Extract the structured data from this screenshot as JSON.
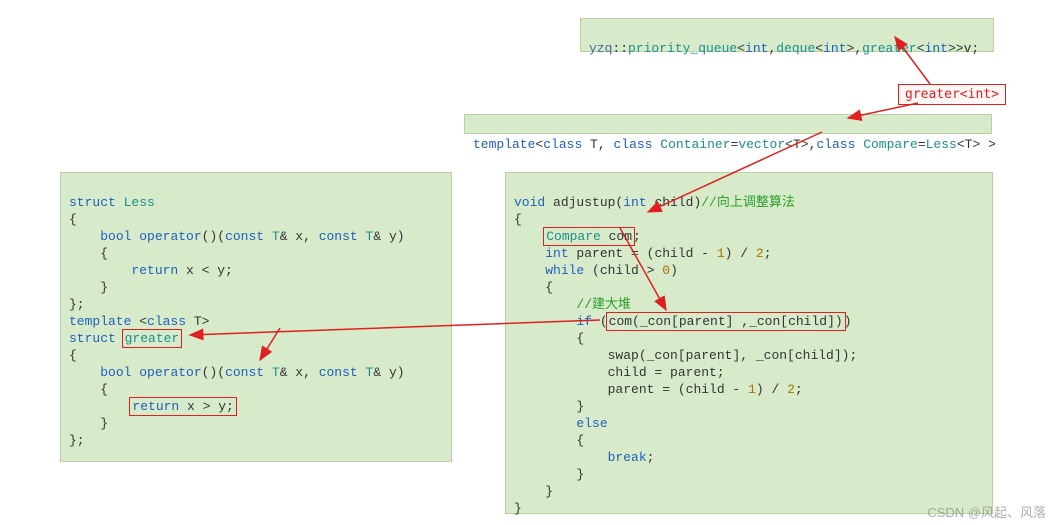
{
  "top_line": {
    "ns1": "yzq",
    "sep": "::",
    "pq": "priority_queue",
    "lt": "<",
    "int1": "int",
    "c1": ",",
    "deque": "deque",
    "lt2": "<",
    "int2": "int",
    "gt2": ">",
    "c2": ",",
    "greater": "greater",
    "lt3": "<",
    "int3": "int",
    "gt3": ">>",
    "v": "v;"
  },
  "annotation_greater": "greater<int>",
  "template_line": {
    "template": "template",
    "lt": "<",
    "class1": "class",
    "T1": " T",
    "c1": ", ",
    "class2": "class",
    "Container": " Container",
    "eq1": "=",
    "vector": "vector",
    "lt2": "<",
    "T2": "T",
    "gt2": ">",
    "c2": ",",
    "class3": "class",
    "Compare": " Compare",
    "eq2": "=",
    "Less": "Less",
    "lt3": "<",
    "T3": "T",
    "gt3": "> ",
    "gt_outer": ">"
  },
  "left_panel": {
    "l1_struct": "struct",
    "l1_Less": " Less",
    "l2": "{",
    "l3_bool": "bool",
    "l3_op": " operator",
    "l3_par": "()(",
    "l3_const1": "const",
    "l3_T1": " T",
    "l3_amp1": "& ",
    "l3_x": "x, ",
    "l3_const2": "const",
    "l3_T2": " T",
    "l3_amp2": "& ",
    "l3_y": "y)",
    "l4": "{",
    "l5_return": "return",
    "l5_expr": " x < y;",
    "l6": "}",
    "l7": "};",
    "l8_template": "template",
    "l8_lt": " <",
    "l8_class": "class",
    "l8_T": " T",
    "l8_gt": ">",
    "l9_struct": "struct",
    "l9_greater": "greater",
    "l10": "{",
    "l11_bool": "bool",
    "l11_op": " operator",
    "l11_par": "()(",
    "l11_const1": "const",
    "l11_T1": " T",
    "l11_amp1": "& ",
    "l11_x": "x, ",
    "l11_const2": "const",
    "l11_T2": " T",
    "l11_amp2": "& ",
    "l11_y": "y)",
    "l12": "{",
    "l13_return": "return",
    "l13_expr": " x > y;",
    "l14": "}",
    "l15": "};"
  },
  "right_panel": {
    "r1_void": "void",
    "r1_name": " adjustup(",
    "r1_int": "int",
    "r1_child": " child)",
    "r1_comment": "//向上调整算法",
    "r2": "{",
    "r3_Compare": "Compare",
    "r3_com": " com",
    "r3_semi": ";",
    "r4_int": "int",
    "r4_expr": " parent = (child - ",
    "r4_one": "1",
    "r4_expr2": ") / ",
    "r4_two": "2",
    "r4_semi": ";",
    "r5_while": "while",
    "r5_cond": " (child > ",
    "r5_zero": "0",
    "r5_close": ")",
    "r6": "{",
    "r7_comment": "//建大堆",
    "r8_if": "if",
    "r8_open": " (",
    "r8_call": "com(_con[parent] ,_con[child])",
    "r8_close": ")",
    "r9": "{",
    "r10": "swap(_con[parent], _con[child]);",
    "r11": "child = parent;",
    "r12_a": "parent = (child - ",
    "r12_one": "1",
    "r12_b": ") / ",
    "r12_two": "2",
    "r12_semi": ";",
    "r13": "}",
    "r14_else": "else",
    "r15": "{",
    "r16_break": "break",
    "r16_semi": ";",
    "r17": "}",
    "r18": "}",
    "r19": "}"
  },
  "watermark": "CSDN @风起、风落"
}
